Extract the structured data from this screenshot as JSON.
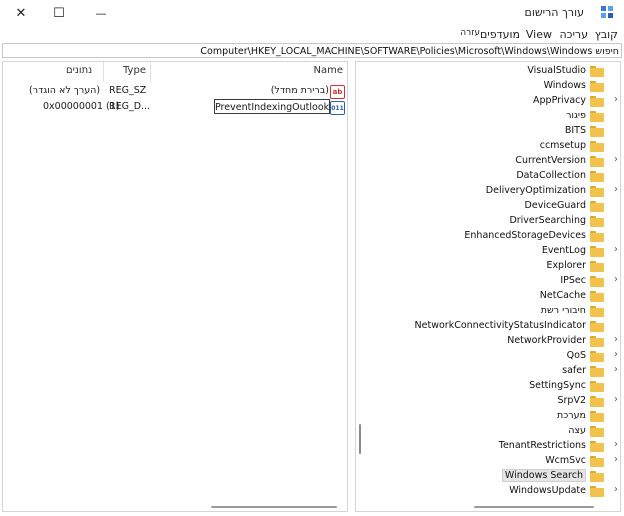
{
  "window": {
    "title": "עורך הרישום",
    "close_glyph": "✕",
    "max_glyph": "☐",
    "min_glyph": "—"
  },
  "menu": {
    "file": "קובץ",
    "edit": "עריכה",
    "view": "View",
    "favorites": "מועדפים",
    "help": "עזרה"
  },
  "address": "Computer\\HKEY_LOCAL_MACHINE\\SOFTWARE\\Policies\\Microsoft\\Windows\\Windows חיפוש",
  "values_pane": {
    "columns": {
      "name": "Name",
      "type": "Type",
      "data": "נתונים"
    },
    "rows": [
      {
        "name": "(ברירת מחדל)",
        "type": "REG_SZ",
        "data": "(הערך לא הוגדר)",
        "icon": "string-value-icon"
      },
      {
        "name": "PreventIndexingOutlook",
        "type": "REG_D...",
        "data": "0x00000001 (1)",
        "icon": "dword-value-icon"
      }
    ]
  },
  "tree": {
    "items": [
      {
        "label": "VisualStudio",
        "expander": false
      },
      {
        "label": "Windows",
        "expander": false
      },
      {
        "label": "AppPrivacy",
        "expander": true
      },
      {
        "label": "פיגור",
        "expander": false
      },
      {
        "label": "BITS",
        "expander": false
      },
      {
        "label": "ccmsetup",
        "expander": false
      },
      {
        "label": "CurrentVersion",
        "expander": true
      },
      {
        "label": "DataCollection",
        "expander": false
      },
      {
        "label": "DeliveryOptimization",
        "expander": true
      },
      {
        "label": "DeviceGuard",
        "expander": false
      },
      {
        "label": "DriverSearching",
        "expander": false
      },
      {
        "label": "EnhancedStorageDevices",
        "expander": false
      },
      {
        "label": "EventLog",
        "expander": true
      },
      {
        "label": "Explorer",
        "expander": false
      },
      {
        "label": "IPSec",
        "expander": true
      },
      {
        "label": "NetCache",
        "expander": false
      },
      {
        "label": "חיבורי רשת",
        "expander": false
      },
      {
        "label": "NetworkConnectivityStatusIndicator",
        "expander": false
      },
      {
        "label": "NetworkProvider",
        "expander": true
      },
      {
        "label": "QoS",
        "expander": true
      },
      {
        "label": "safer",
        "expander": true
      },
      {
        "label": "SettingSync",
        "expander": false
      },
      {
        "label": "SrpV2",
        "expander": true
      },
      {
        "label": "מערכת",
        "expander": false
      },
      {
        "label": "עצה",
        "expander": false
      },
      {
        "label": "TenantRestrictions",
        "expander": true
      },
      {
        "label": "WcmSvc",
        "expander": true
      },
      {
        "label": "Windows Search",
        "expander": false,
        "selected": true
      },
      {
        "label": "WindowsUpdate",
        "expander": true
      }
    ]
  }
}
